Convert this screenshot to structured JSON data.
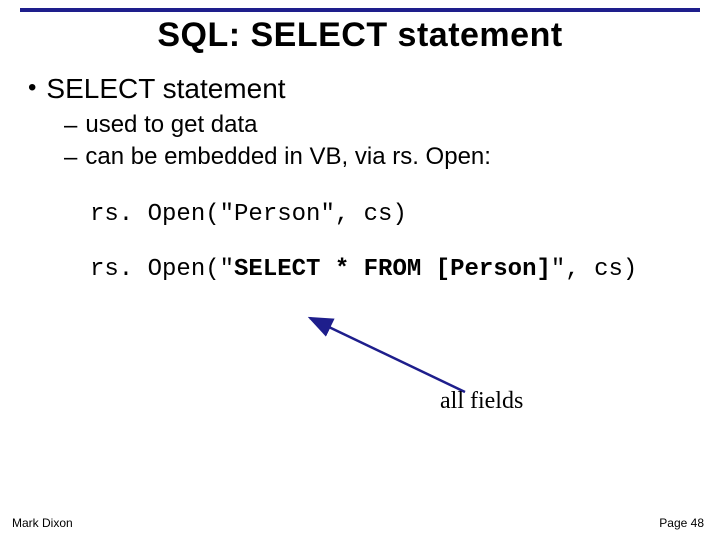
{
  "title": "SQL: SELECT statement",
  "bullets": {
    "lvl1": "SELECT statement",
    "lvl2a": "used to get data",
    "lvl2b": "can be embedded in VB, via rs. Open:"
  },
  "code": {
    "line1": "rs. Open(\"Person\", cs)",
    "line2_prefix": "rs. Open(\"",
    "line2_bold": "SELECT * FROM [Person]",
    "line2_suffix": "\", cs)"
  },
  "annotation": "all fields",
  "footer": {
    "left": "Mark Dixon",
    "right": "Page 48"
  }
}
